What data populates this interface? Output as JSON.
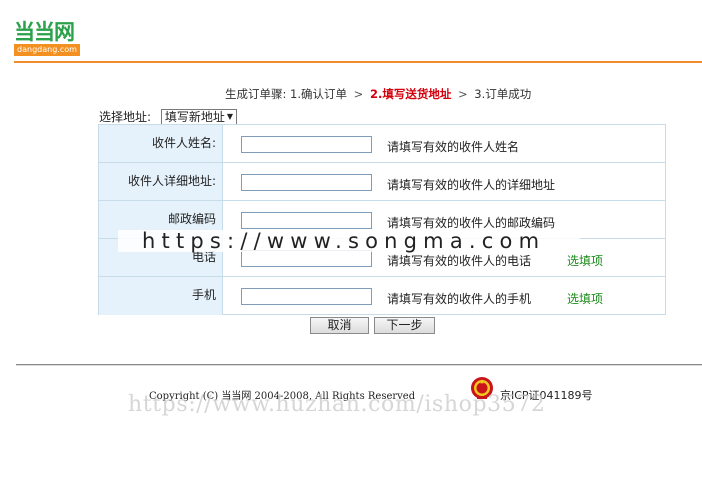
{
  "logo": {
    "cn": "当当网",
    "en": "dangdang.com"
  },
  "steps": {
    "prefix": "生成订单骤:",
    "step1": "1.确认订单",
    "step2": "2.填写送货地址",
    "step3": "3.订单成功",
    "separator": ">"
  },
  "address_select": {
    "label": "选择地址:",
    "selected": "填写新地址"
  },
  "form": {
    "rows": [
      {
        "label": "收件人姓名:",
        "hint": "请填写有效的收件人姓名",
        "optional": ""
      },
      {
        "label": "收件人详细地址:",
        "hint": "请填写有效的收件人的详细地址",
        "optional": ""
      },
      {
        "label": "邮政编码",
        "hint": "请填写有效的收件人的邮政编码",
        "optional": ""
      },
      {
        "label": "电话",
        "hint": "请填写有效的收件人的电话",
        "optional": "选填项"
      },
      {
        "label": "手机",
        "hint": "请填写有效的收件人的手机",
        "optional": "选填项"
      }
    ]
  },
  "buttons": {
    "cancel": "取消",
    "next": "下一步"
  },
  "footer": {
    "copyright": "Copyright (C) 当当网 2004-2008, All Rights Reserved",
    "icp": "京ICP证041189号"
  },
  "watermarks": {
    "top": "https://www.songma.com",
    "bottom": "https://www.huzhan.com/ishop3572"
  },
  "colors": {
    "accent_orange": "#f18b2c",
    "logo_green": "#2aa14a",
    "current_step_red": "#d4000c",
    "optional_green": "#1a8a1a",
    "label_bg": "#e6f2fb"
  }
}
